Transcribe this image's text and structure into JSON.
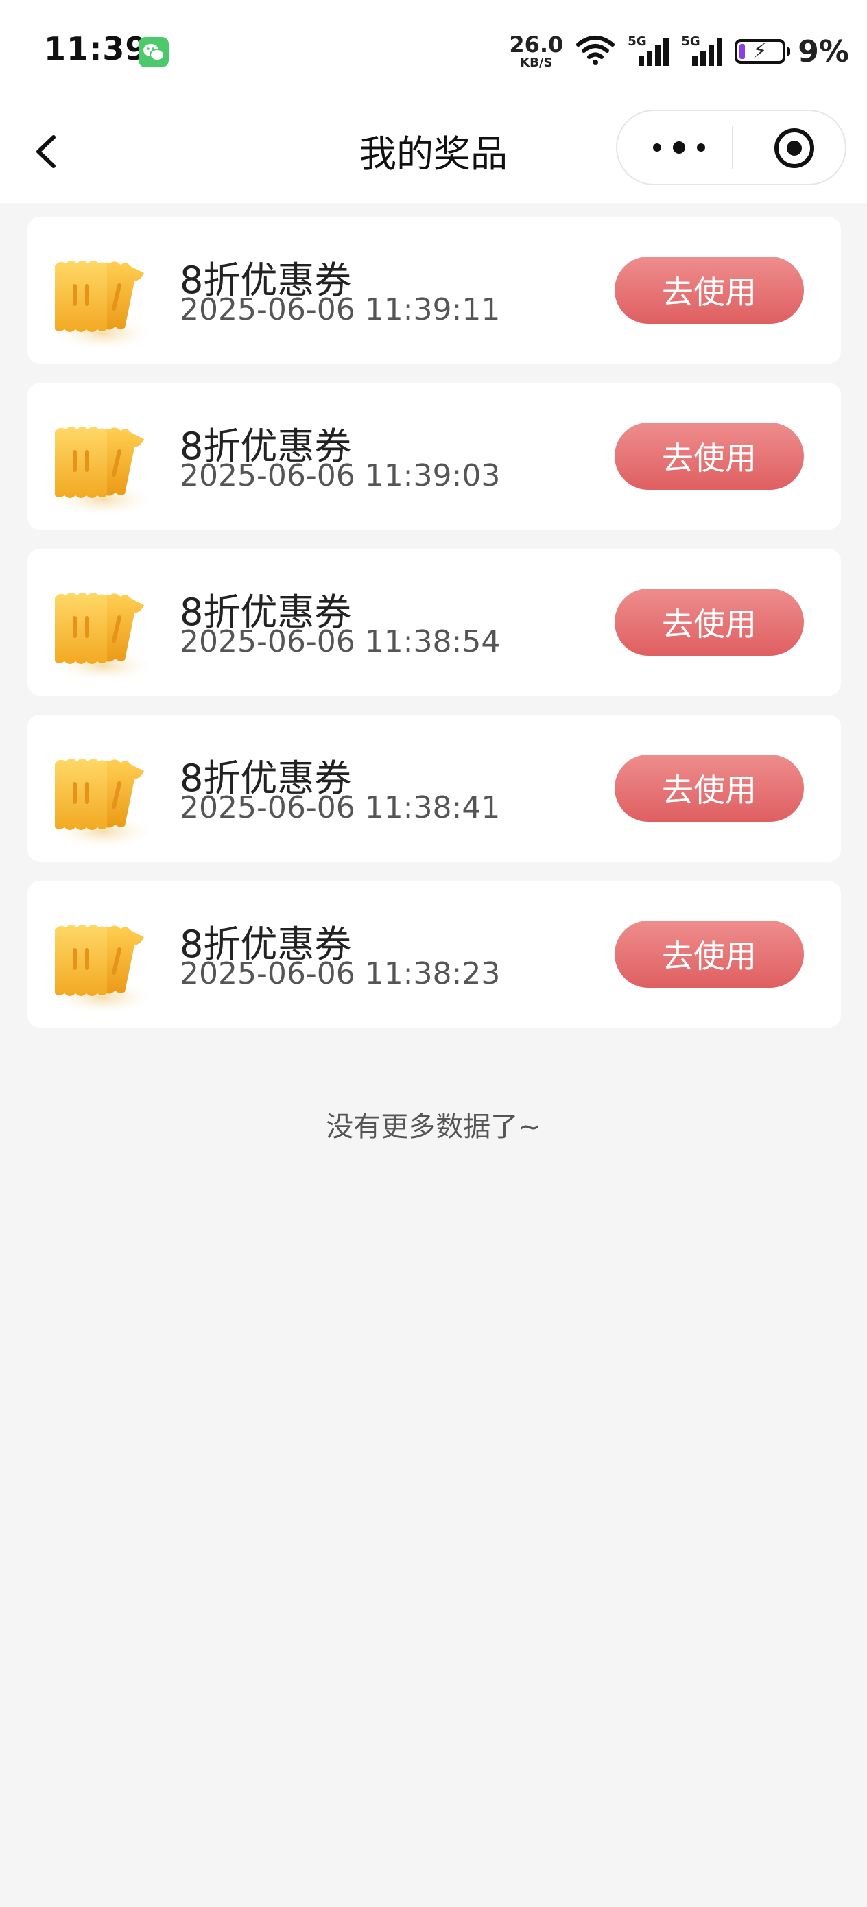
{
  "status_bar": {
    "time": "11:39",
    "network_speed": "26.0",
    "network_speed_unit": "KB/S",
    "signal_1_label": "5G",
    "signal_2_label": "5G",
    "battery_percent": "9%",
    "battery_level": 0.09,
    "battery_charging_color": "#8a3fe0",
    "wechat_icon_color": "#4cc96a"
  },
  "navbar": {
    "title": "我的奖品",
    "back_icon": "chevron-left-icon",
    "more_icon": "more-dots-icon",
    "close_icon": "target-close-icon"
  },
  "prizes": [
    {
      "name": "8折优惠券",
      "time": "2025-06-06 11:39:11",
      "action": "去使用"
    },
    {
      "name": "8折优惠券",
      "time": "2025-06-06 11:39:03",
      "action": "去使用"
    },
    {
      "name": "8折优惠券",
      "time": "2025-06-06 11:38:54",
      "action": "去使用"
    },
    {
      "name": "8折优惠券",
      "time": "2025-06-06 11:38:41",
      "action": "去使用"
    },
    {
      "name": "8折优惠券",
      "time": "2025-06-06 11:38:23",
      "action": "去使用"
    }
  ],
  "footer": {
    "no_more_text": "没有更多数据了~"
  },
  "colors": {
    "accent_button_top": "#ee8d8d",
    "accent_button_bottom": "#df5f61",
    "page_background": "#f5f5f5",
    "ticket_yellow": "#f7c236"
  }
}
